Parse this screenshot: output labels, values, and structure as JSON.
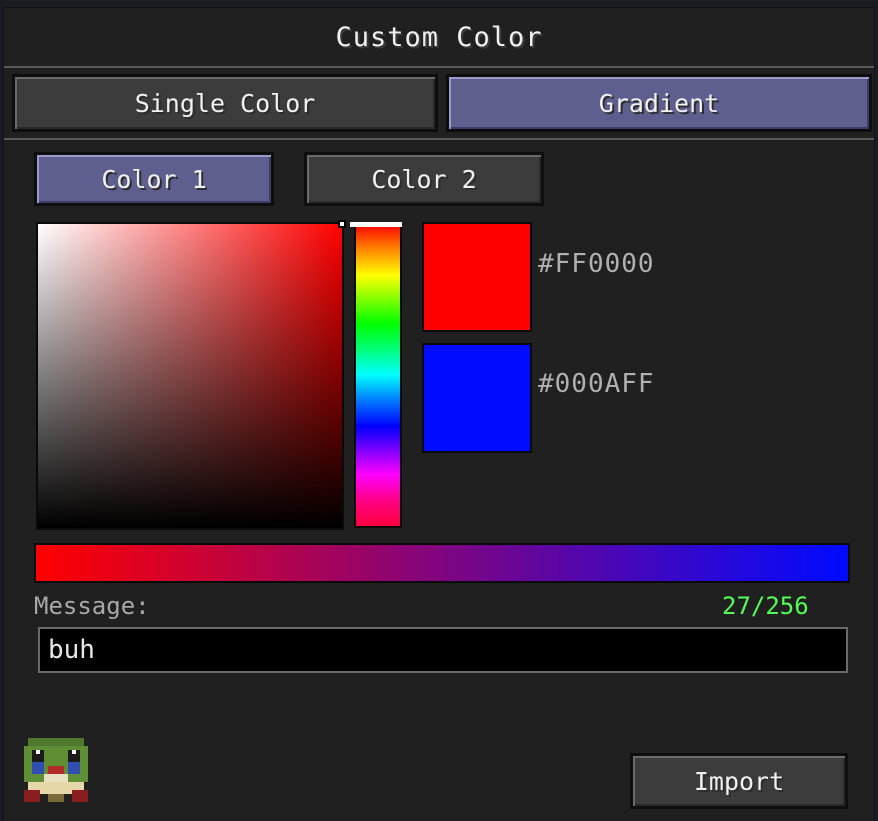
{
  "window": {
    "title": "Custom Color"
  },
  "mode_tabs": {
    "single": "Single Color",
    "gradient": "Gradient",
    "active": "gradient"
  },
  "color_tabs": {
    "color1": "Color 1",
    "color2": "Color 2",
    "active": "color1"
  },
  "picker": {
    "hue_degrees": 0,
    "saturation": 1.0,
    "brightness": 1.0
  },
  "colors": [
    {
      "hex_label": "#FF0000",
      "value": "#FF0000"
    },
    {
      "hex_label": "#000AFF",
      "value": "#000AFF"
    }
  ],
  "gradient": {
    "from": "#FF0000",
    "to": "#000AFF"
  },
  "message": {
    "label": "Message:",
    "value": "buh",
    "counter": "27/256",
    "counter_color": "#55ff55"
  },
  "actions": {
    "import": "Import"
  },
  "icons": {
    "avatar": "frog-icon"
  }
}
